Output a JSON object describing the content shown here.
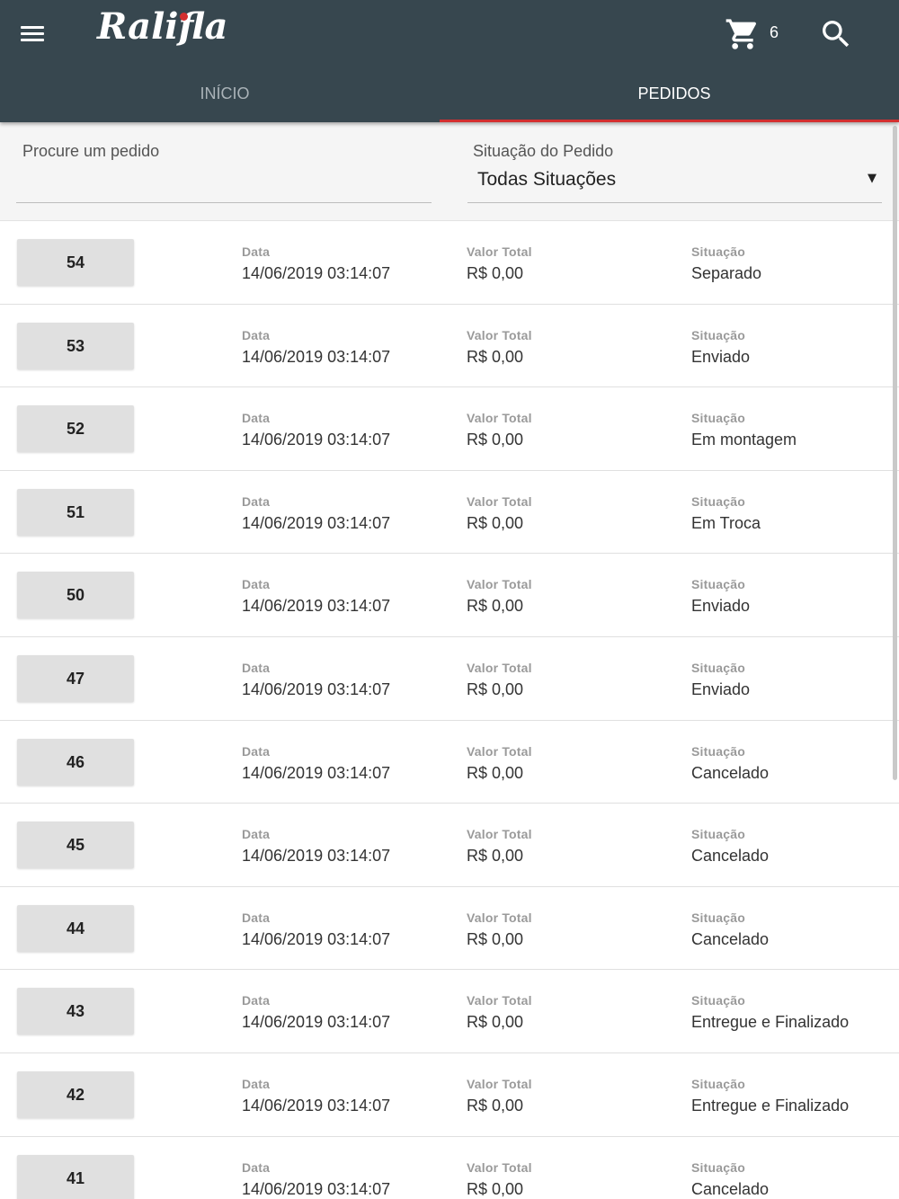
{
  "app": {
    "logo": "Ralifla",
    "cart_count": "6",
    "icons": {
      "menu": "menu-icon",
      "cart": "cart-icon",
      "search": "search-icon",
      "dropdown": "dropdown-arrow-icon"
    },
    "colors": {
      "appbar": "#37474f",
      "accent": "#d32f2f",
      "tab_inactive": "#aab3b8"
    }
  },
  "tabs": [
    {
      "label": "INÍCIO",
      "active": false
    },
    {
      "label": "PEDIDOS",
      "active": true
    }
  ],
  "filters": {
    "search_label": "Procure um pedido",
    "search_value": "",
    "status_label": "Situação do Pedido",
    "status_value": "Todas Situações"
  },
  "labels": {
    "date": "Data",
    "total": "Valor Total",
    "status": "Situação"
  },
  "orders": [
    {
      "number": "54",
      "date": "14/06/2019 03:14:07",
      "total": "R$ 0,00",
      "status": "Separado"
    },
    {
      "number": "53",
      "date": "14/06/2019 03:14:07",
      "total": "R$ 0,00",
      "status": "Enviado"
    },
    {
      "number": "52",
      "date": "14/06/2019 03:14:07",
      "total": "R$ 0,00",
      "status": "Em montagem"
    },
    {
      "number": "51",
      "date": "14/06/2019 03:14:07",
      "total": "R$ 0,00",
      "status": "Em Troca"
    },
    {
      "number": "50",
      "date": "14/06/2019 03:14:07",
      "total": "R$ 0,00",
      "status": "Enviado"
    },
    {
      "number": "47",
      "date": "14/06/2019 03:14:07",
      "total": "R$ 0,00",
      "status": "Enviado"
    },
    {
      "number": "46",
      "date": "14/06/2019 03:14:07",
      "total": "R$ 0,00",
      "status": "Cancelado"
    },
    {
      "number": "45",
      "date": "14/06/2019 03:14:07",
      "total": "R$ 0,00",
      "status": "Cancelado"
    },
    {
      "number": "44",
      "date": "14/06/2019 03:14:07",
      "total": "R$ 0,00",
      "status": "Cancelado"
    },
    {
      "number": "43",
      "date": "14/06/2019 03:14:07",
      "total": "R$ 0,00",
      "status": "Entregue e Finalizado"
    },
    {
      "number": "42",
      "date": "14/06/2019 03:14:07",
      "total": "R$ 0,00",
      "status": "Entregue e Finalizado"
    },
    {
      "number": "41",
      "date": "14/06/2019 03:14:07",
      "total": "R$ 0,00",
      "status": "Cancelado"
    }
  ]
}
